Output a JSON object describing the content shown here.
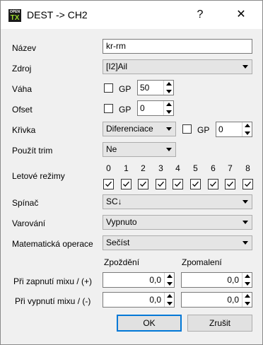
{
  "window": {
    "title": "DEST -> CH2",
    "icon_top": "OPEN",
    "icon_bottom": "TX",
    "help_glyph": "?",
    "close_glyph": "✕"
  },
  "fields": {
    "name_label": "Název",
    "name_value": "kr-rm",
    "source_label": "Zdroj",
    "source_value": "[I2]Ail",
    "weight_label": "Váha",
    "weight_gp": "GP",
    "weight_value": "50",
    "offset_label": "Ofset",
    "offset_gp": "GP",
    "offset_value": "0",
    "curve_label": "Křivka",
    "curve_type": "Diferenciace",
    "curve_gp": "GP",
    "curve_value": "0",
    "trim_label": "Použít trim",
    "trim_value": "Ne",
    "flight_modes_label": "Letové režimy",
    "flight_modes": [
      "0",
      "1",
      "2",
      "3",
      "4",
      "5",
      "6",
      "7",
      "8"
    ],
    "switch_label": "Spínač",
    "switch_value": "SC↓",
    "warning_label": "Varování",
    "warning_value": "Vypnuto",
    "math_label": "Matematická operace",
    "math_value": "Sečíst"
  },
  "delays": {
    "delay_header": "Zpoždění",
    "slow_header": "Zpomalení",
    "on_label": "Při zapnutí mixu / (+)",
    "off_label": "Při vypnutí mixu / (-)",
    "on_delay": "0,0",
    "on_slow": "0,0",
    "off_delay": "0,0",
    "off_slow": "0,0"
  },
  "buttons": {
    "ok": "OK",
    "cancel": "Zrušit"
  },
  "colors": {
    "accent": "#0078d7",
    "window_bg": "#f0f0f0"
  }
}
